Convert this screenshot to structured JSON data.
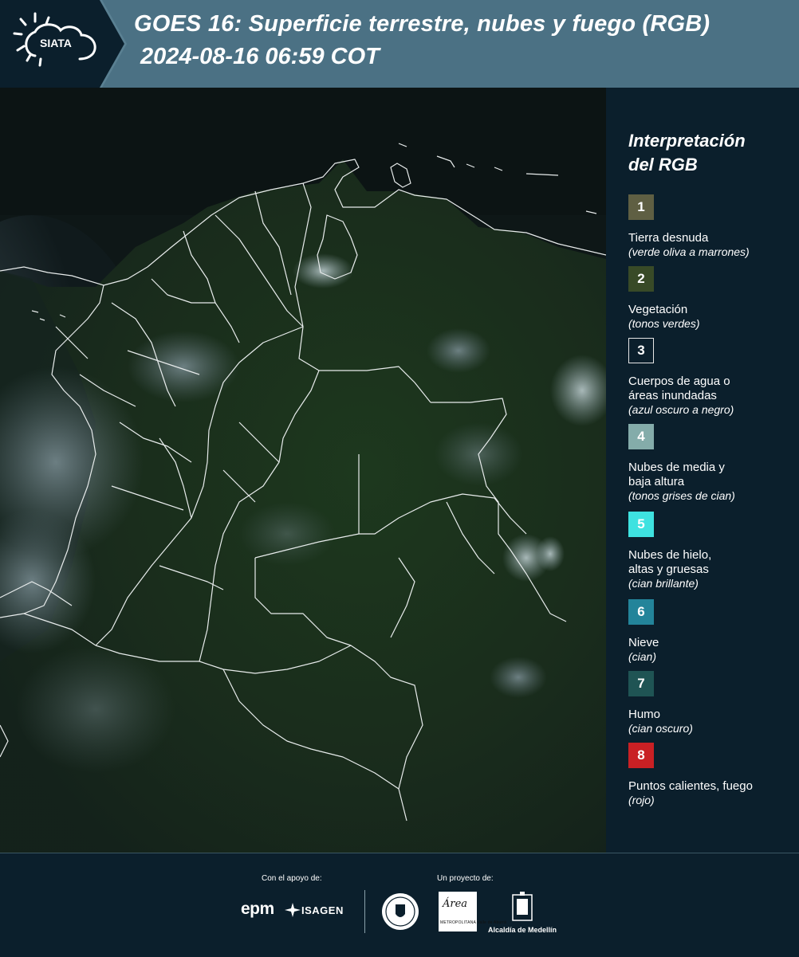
{
  "header": {
    "title_line1": "GOES 16: Superficie terrestre, nubes y fuego (RGB)",
    "title_line2": "2024-08-16 06:59 COT",
    "logo_text": "SIATA",
    "logo_icon": "sun-cloud-icon",
    "background": "#4b7184"
  },
  "legend": {
    "title_line1": "Interpretación",
    "title_line2": "del RGB",
    "items": [
      {
        "number": "1",
        "label": "Tierra desnuda",
        "desc": "(verde oliva a marrones)",
        "color": "#5f5f43"
      },
      {
        "number": "2",
        "label": "Vegetación",
        "desc": "(tonos verdes)",
        "color": "#384a27"
      },
      {
        "number": "3",
        "label1": "Cuerpos de agua o",
        "label2": "áreas inundadas",
        "desc": "(azul oscuro a negro)",
        "color": "#0b1f2c"
      },
      {
        "number": "4",
        "label1": "Nubes de media y",
        "label2": "baja altura",
        "desc": "(tonos grises de cian)",
        "color": "#84acaa"
      },
      {
        "number": "5",
        "label1": "Nubes de hielo,",
        "label2": "altas y gruesas",
        "desc": "(cian brillante)",
        "color": "#3ee2e0"
      },
      {
        "number": "6",
        "label": "Nieve",
        "desc": "(cian)",
        "color": "#23849a"
      },
      {
        "number": "7",
        "label": "Humo",
        "desc": "(cian oscuro)",
        "color": "#1f5454"
      },
      {
        "number": "8",
        "label": "Puntos calientes, fuego",
        "desc": "(rojo)",
        "color": "#c92024"
      }
    ]
  },
  "footer": {
    "support_label": "Con el apoyo de:",
    "project_label": "Un proyecto de:",
    "sponsor_1": "epm",
    "sponsor_2": "ISAGEN",
    "partner_1_icon": "medellin-university-seal-icon",
    "partner_2_name": "Área",
    "partner_2_sub": "METROPOLITANA Valle de Aburrá",
    "partner_3": "Alcaldía de Medellín",
    "partner_3_icon": "medellin-coat-of-arms-icon"
  }
}
